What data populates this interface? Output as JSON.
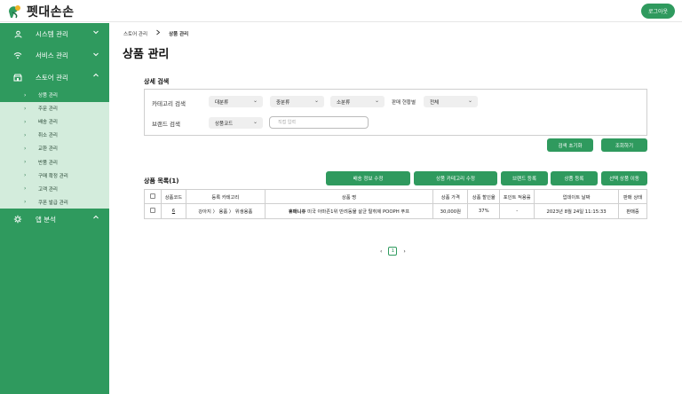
{
  "brand": {
    "name": "펫대손손"
  },
  "header": {
    "logout_label": "로그아웃"
  },
  "sidebar": {
    "groups": [
      {
        "label": "시스템 관리",
        "icon": "user-icon",
        "chevron": "⌄"
      },
      {
        "label": "서비스 관리",
        "icon": "wifi-icon",
        "chevron": "⌄"
      },
      {
        "label": "스토어 관리",
        "icon": "store-icon",
        "chevron": "⌃"
      }
    ],
    "store_items": [
      {
        "label": "상품 관리"
      },
      {
        "label": "주문 관리"
      },
      {
        "label": "배송 관리"
      },
      {
        "label": "취소 관리"
      },
      {
        "label": "교환 관리"
      },
      {
        "label": "반품 관리"
      },
      {
        "label": "구매 확정 관리"
      },
      {
        "label": "고객 관리"
      },
      {
        "label": "쿠폰 발급 관리"
      }
    ],
    "extra_group": {
      "label": "앱 분석",
      "icon": "gear-icon",
      "chevron": "⌃"
    }
  },
  "breadcrumb": {
    "parent": "스토어 관리",
    "current": "상품 관리"
  },
  "page_title": "상품 관리",
  "search": {
    "title": "상세 검색",
    "category_label": "카테고리 검색",
    "category_selects": [
      "대분류",
      "중분류",
      "소분류"
    ],
    "sale_status_label": "판매 현황별",
    "sale_status_value": "전체",
    "brand_label": "브랜드 검색",
    "brand_select": "상품코드",
    "brand_placeholder": "직접 입력",
    "reset_button": "검색 초기화",
    "submit_button": "조회하기"
  },
  "list": {
    "title": "상품 목록(1)",
    "actions": [
      "배송 정보 수정",
      "상품 카테고리 수정",
      "브랜드 등록",
      "상품 등록",
      "선택 상품 이동"
    ],
    "columns": [
      "",
      "상품코드",
      "등록 카테고리",
      "상품 명",
      "상품 가격",
      "상품 할인율",
      "포인트 적용률",
      "업데이트 날짜",
      "판매 상태"
    ],
    "rows": [
      {
        "code": "6",
        "category": "강아지 〉 용품 〉 위생용품",
        "name_brand": "휴매니쥬",
        "name_rest": " 미국 아마존1위 반려동물 살균 탈취제 POOPH 푸프",
        "price": "30,000원",
        "discount": "37%",
        "point": "-",
        "updated": "2023년 8월 24일 11:15:33",
        "status": "판매중"
      }
    ]
  },
  "pagination": {
    "prev": "‹",
    "current": "1",
    "next": "›"
  },
  "colors": {
    "brand_green": "#2f9a5e",
    "submenu_bg": "#d3ecdc"
  }
}
